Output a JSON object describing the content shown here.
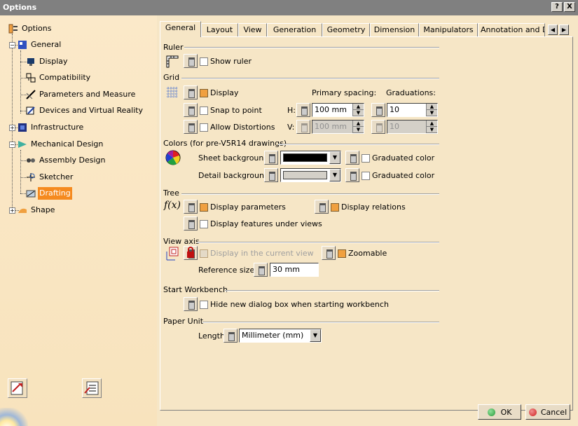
{
  "window": {
    "title": "Options",
    "help_label": "?",
    "close_label": "X"
  },
  "tree": {
    "root": "Options",
    "general": "General",
    "display": "Display",
    "compatibility": "Compatibility",
    "parameters": "Parameters and Measure",
    "devices": "Devices and Virtual Reality",
    "infrastructure": "Infrastructure",
    "mechanical": "Mechanical Design",
    "assembly": "Assembly Design",
    "sketcher": "Sketcher",
    "drafting": "Drafting",
    "shape": "Shape"
  },
  "tabs": [
    "General",
    "Layout",
    "View",
    "Generation",
    "Geometry",
    "Dimension",
    "Manipulators",
    "Annotation and Dr"
  ],
  "active_tab": "General",
  "ruler": {
    "title": "Ruler",
    "show_ruler": "Show ruler"
  },
  "grid": {
    "title": "Grid",
    "display": "Display",
    "snap": "Snap to point",
    "distortions": "Allow Distortions",
    "primary_spacing": "Primary spacing:",
    "graduations": "Graduations:",
    "h_label": "H:",
    "v_label": "V:",
    "h_spacing": "100 mm",
    "v_spacing": "100 mm",
    "h_grad": "10",
    "v_grad": "10"
  },
  "colors": {
    "title": "Colors (for pre-V5R14 drawings)",
    "sheet_bg": "Sheet background:",
    "detail_bg": "Detail background:",
    "graduated": "Graduated color",
    "sheet_color": "#000000",
    "detail_color": "#d4d0c8"
  },
  "tree_section": {
    "title": "Tree",
    "display_params": "Display parameters",
    "display_relations": "Display relations",
    "display_features": "Display features under views"
  },
  "view_axis": {
    "title": "View axis",
    "display_current": "Display in the current view",
    "zoomable": "Zoomable",
    "reference_size": "Reference size:",
    "reference_value": "30 mm"
  },
  "start_workbench": {
    "title": "Start Workbench",
    "hide_dialog": "Hide new dialog box when starting workbench"
  },
  "paper_unit": {
    "title": "Paper Unit",
    "length": "Length",
    "length_value": "Millimeter (mm)"
  },
  "buttons": {
    "ok": "OK",
    "cancel": "Cancel"
  },
  "icons": {
    "fx": "f(x)"
  },
  "colors_ui": {
    "selection": "#f58a1f",
    "background": "#f6e6c6",
    "ok_green": "#2a9a3a",
    "cancel_red": "#d02020"
  }
}
